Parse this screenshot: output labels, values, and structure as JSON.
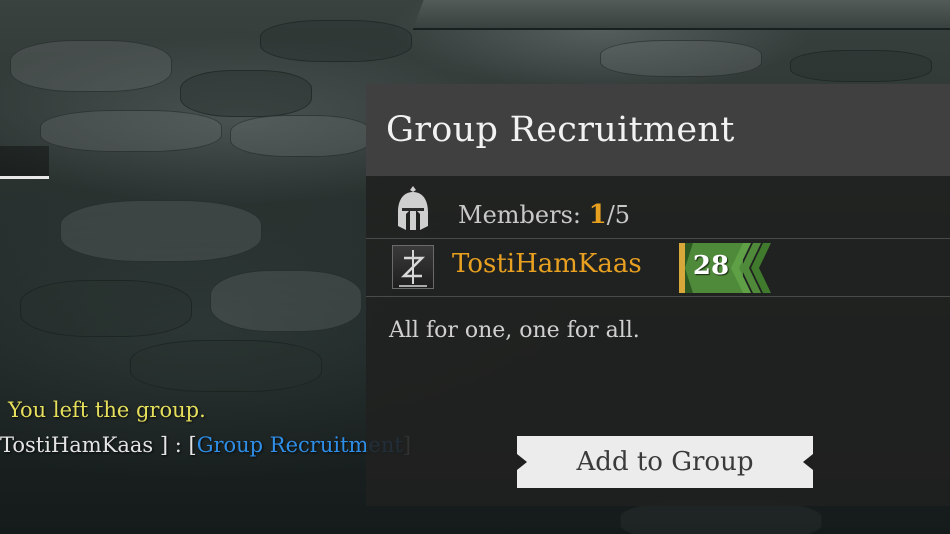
{
  "chat": {
    "system_message": "You left the group.",
    "sender_prefix": "TostiHamKaas ] : [",
    "link_text": "Group Recruitment",
    "link_close": "]"
  },
  "recruitment": {
    "title": "Group Recruitment",
    "members_label": "Members: ",
    "members_current": "1",
    "members_max": "/5",
    "member": {
      "name": "TostiHamKaas",
      "level": "28"
    },
    "description": "All for one, one for all.",
    "add_button_label": "Add to Group"
  },
  "icons": {
    "members": "helmet-icon",
    "member_class": "class-icon",
    "level_badge": "level-badge-icon"
  },
  "colors": {
    "accent_orange": "#e8a020",
    "system_yellow": "#e6df5c",
    "link_blue": "#2e8ee8",
    "level_green": "#4f8a3a"
  }
}
